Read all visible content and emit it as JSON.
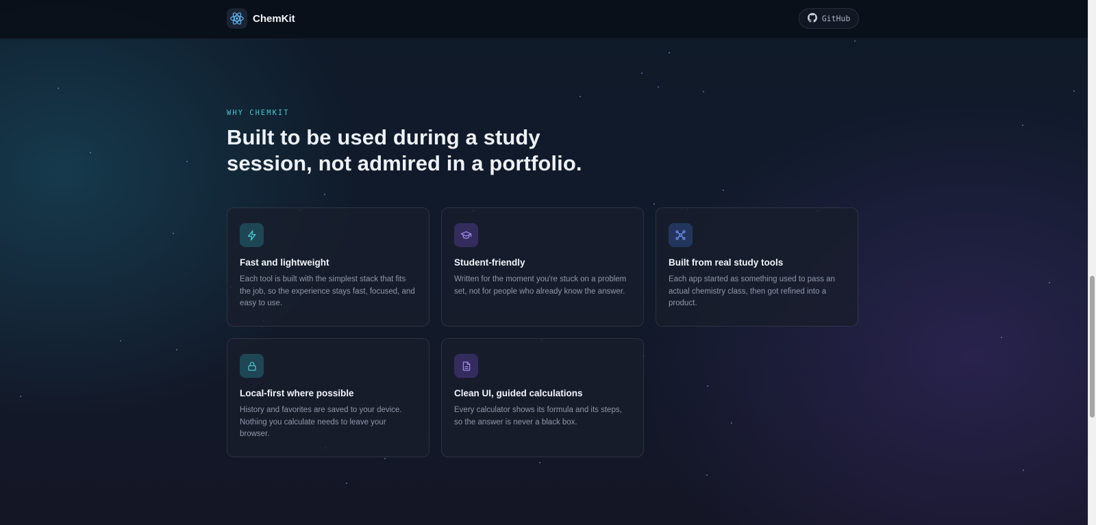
{
  "app": {
    "name": "ChemKit",
    "github_label": "GitHub"
  },
  "section": {
    "eyebrow": "WHY CHEMKIT",
    "headline": "Built to be used during a study session, not admired in a portfolio."
  },
  "features": [
    {
      "icon": "lightning-icon",
      "accent": "#4fc3cf",
      "title": "Fast and lightweight",
      "description": "Each tool is built with the simplest stack that fits the job, so the experience stays fast, focused, and easy to use."
    },
    {
      "icon": "graduation-cap-icon",
      "accent": "#a58cf0",
      "title": "Student-friendly",
      "description": "Written for the moment you're stuck on a problem set, not for people who already know the answer."
    },
    {
      "icon": "network-icon",
      "accent": "#6f95f5",
      "title": "Built from real study tools",
      "description": "Each app started as something used to pass an actual chemistry class, then got refined into a product."
    },
    {
      "icon": "lock-icon",
      "accent": "#4fc3cf",
      "title": "Local-first where possible",
      "description": "History and favorites are saved to your device. Nothing you calculate needs to leave your browser."
    },
    {
      "icon": "document-icon",
      "accent": "#a58cf0",
      "title": "Clean UI, guided calculations",
      "description": "Every calculator shows its formula and its steps, so the answer is never a black box."
    }
  ]
}
